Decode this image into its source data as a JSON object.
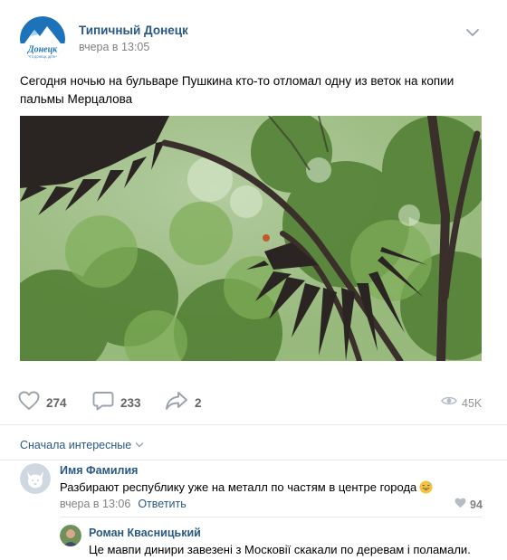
{
  "post": {
    "group_name": "Типичный Донецк",
    "time": "вчера в 13:05",
    "text": "Сегодня ночью на бульваре Пушкина кто-то отломал одну из веток на копии пальмы Мерцалова",
    "avatar_label": "Донецк",
    "avatar_sublabel": "ЭТО ДОНЕЦК, ДЕТКА",
    "likes": "274",
    "comments": "233",
    "shares": "2",
    "views": "45K"
  },
  "comments_section": {
    "sort_label": "Сначала интересные",
    "comments": [
      {
        "author": "Имя Фамилия",
        "text": "Разбирают республику уже на металл по частям в центре города",
        "time": "вчера в 13:06",
        "reply_label": "Ответить",
        "likes": "94",
        "emoji": "grinning-sweat-emoji"
      },
      {
        "author": "Роман Квасницький",
        "text": "Це мавпи динири завезені з Московії скакали по деревам і поламали."
      }
    ]
  },
  "colors": {
    "link": "#2a5885",
    "muted": "#828282",
    "divider": "#e7e8ec",
    "icon": "#99a2ad"
  }
}
